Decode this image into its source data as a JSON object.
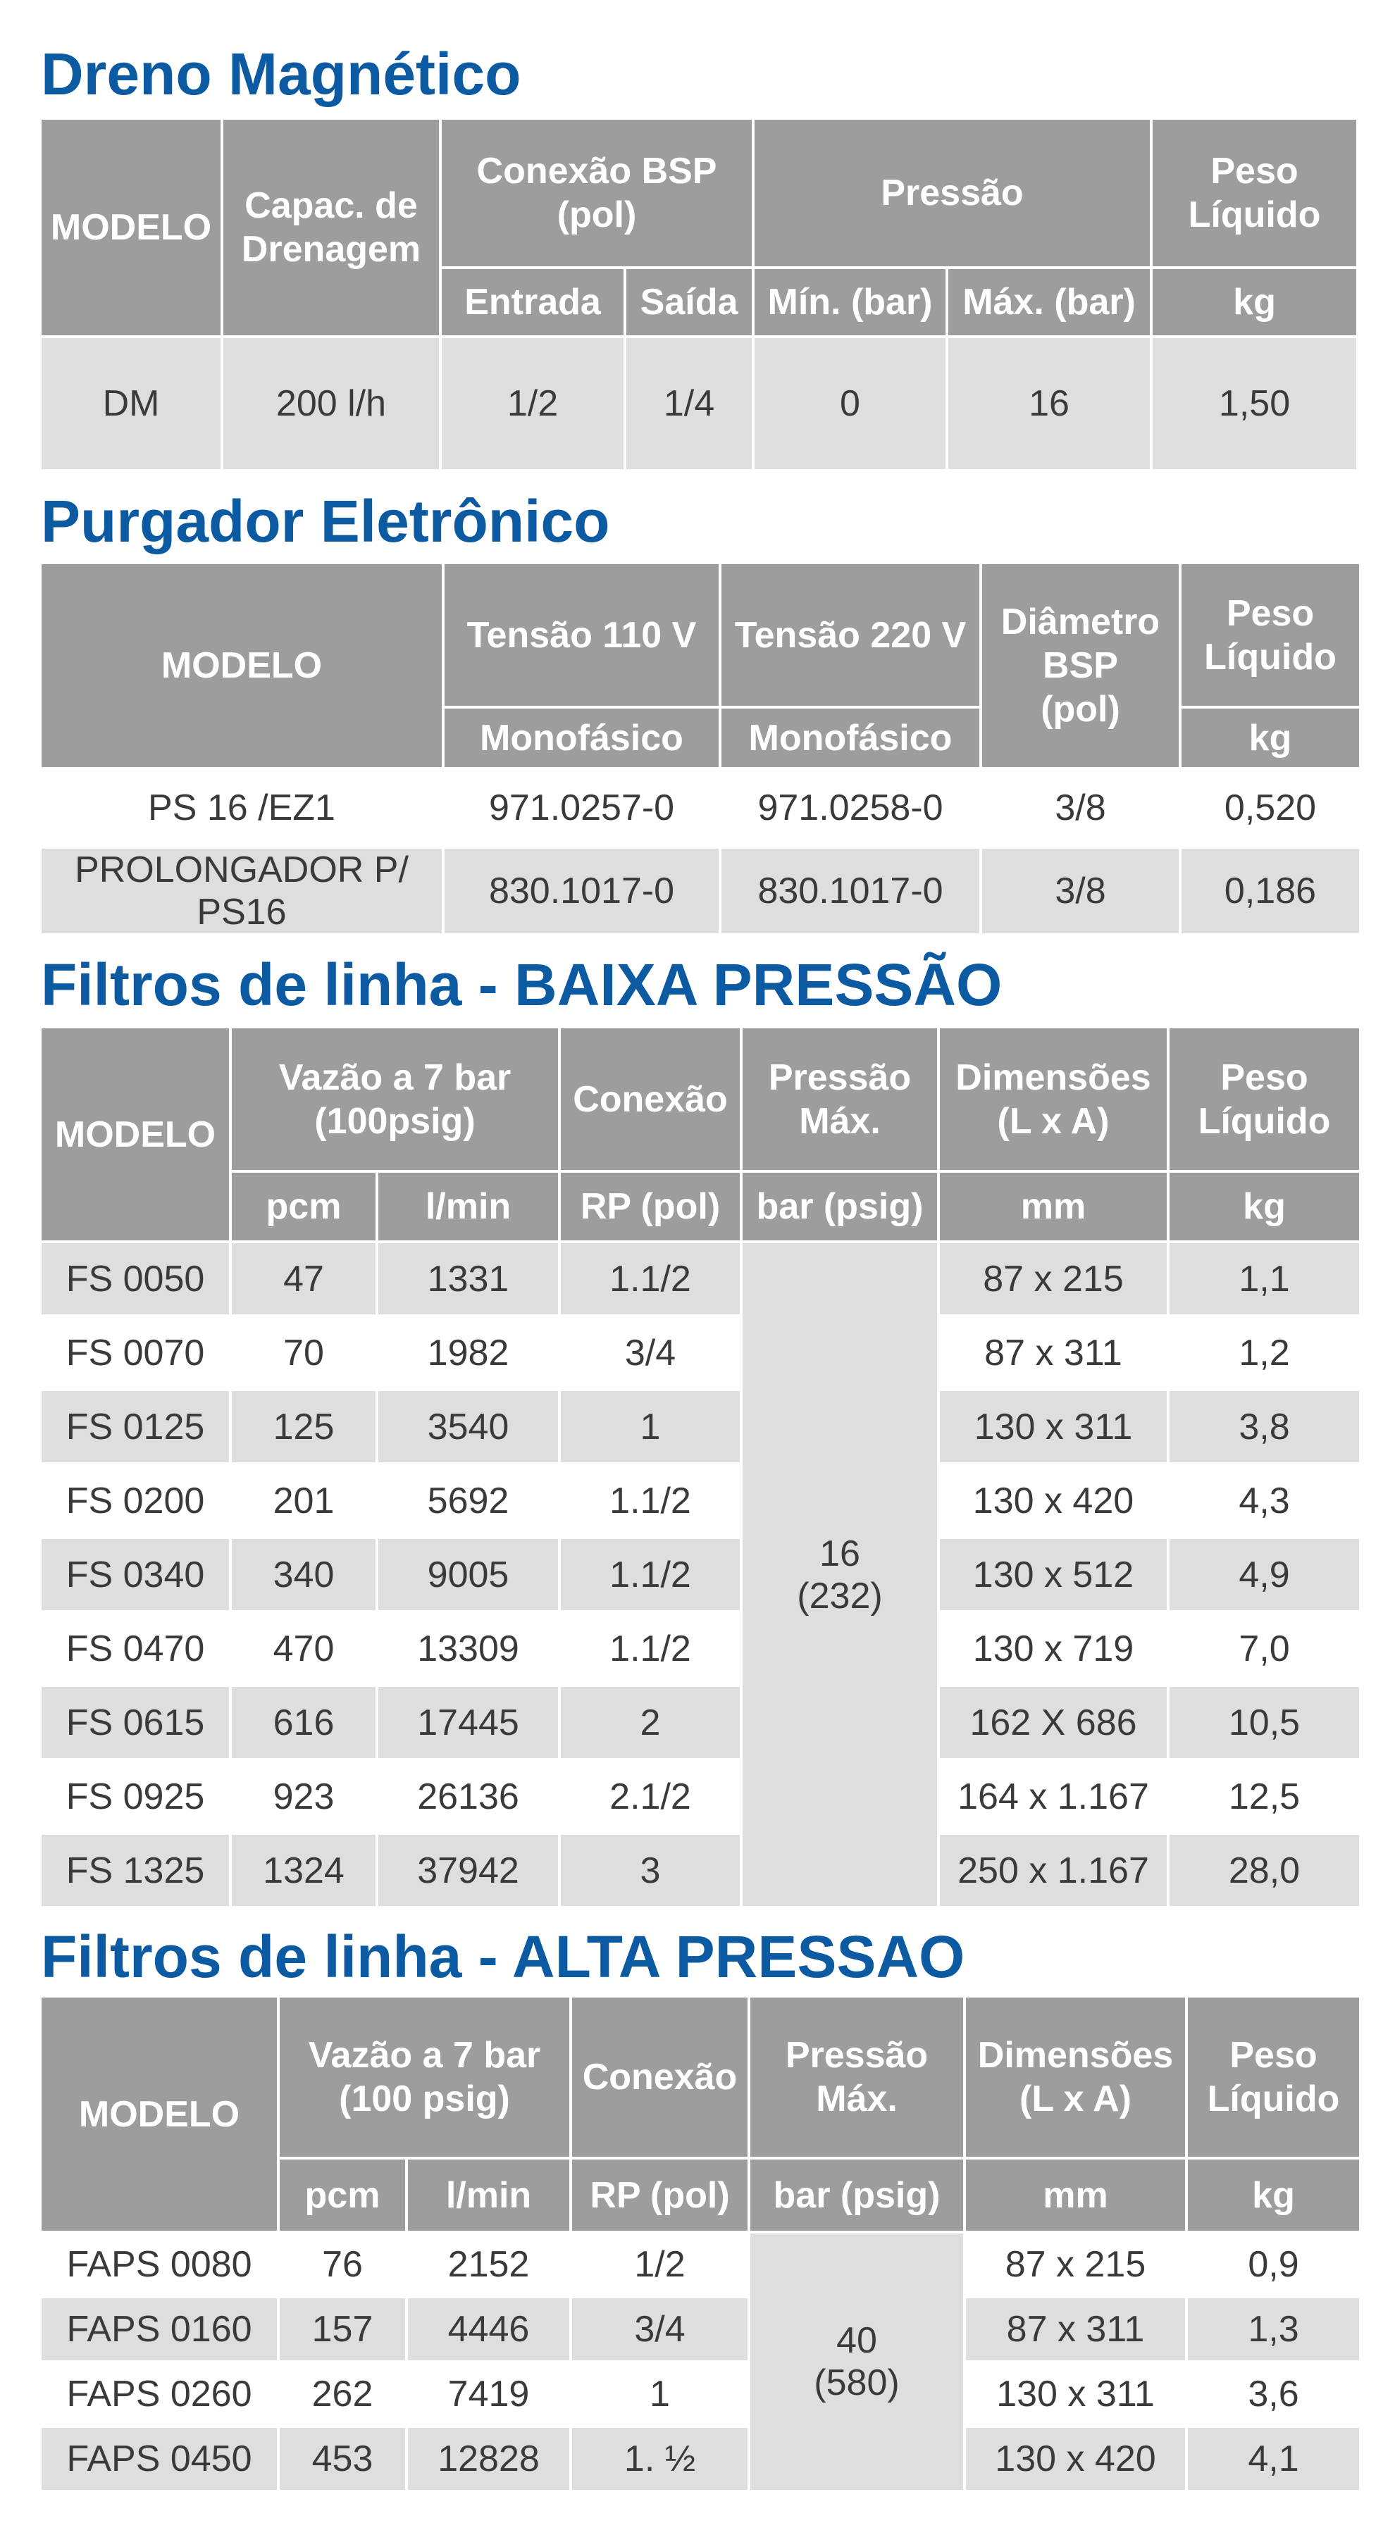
{
  "dreno": {
    "title": "Dreno Magnético",
    "headers": {
      "modelo": "MODELO",
      "capac": "Capac. de\nDrenagem",
      "conexao": "Conexão BSP\n(pol)",
      "pressao": "Pressão",
      "peso": "Peso\nLíquido",
      "entrada": "Entrada",
      "saida": "Saída",
      "min": "Mín. (bar)",
      "max": "Máx. (bar)",
      "kg": "kg"
    },
    "rows": [
      {
        "modelo": "DM",
        "capac": "200 l/h",
        "entrada": "1/2",
        "saida": "1/4",
        "min": "0",
        "max": "16",
        "peso": "1,50"
      }
    ]
  },
  "purgador": {
    "title": "Purgador Eletrônico",
    "headers": {
      "modelo": "MODELO",
      "t110": "Tensão 110 V",
      "t220": "Tensão 220 V",
      "diametro": "Diâmetro\nBSP\n(pol)",
      "peso": "Peso\nLíquido",
      "mono110": "Monofásico",
      "mono220": "Monofásico",
      "kg": "kg"
    },
    "rows": [
      {
        "modelo": "PS 16 /EZ1",
        "t110": "971.0257-0",
        "t220": "971.0258-0",
        "diametro": "3/8",
        "peso": "0,520"
      },
      {
        "modelo": "PROLONGADOR P/ PS16",
        "t110": "830.1017-0",
        "t220": "830.1017-0",
        "diametro": "3/8",
        "peso": "0,186"
      }
    ]
  },
  "baixa": {
    "title": "Filtros de linha - BAIXA PRESSÃO",
    "headers": {
      "modelo": "MODELO",
      "vazao": "Vazão a 7 bar\n(100psig)",
      "conexao": "Conexão",
      "pressao": "Pressão\nMáx.",
      "dimensoes": "Dimensões\n(L x A)",
      "peso": "Peso\nLíquido",
      "pcm": "pcm",
      "lmin": "l/min",
      "rp": "RP (pol)",
      "bar": "bar (psig)",
      "mm": "mm",
      "kg": "kg"
    },
    "pressao_merged": "16\n(232)",
    "rows": [
      {
        "modelo": "FS 0050",
        "pcm": "47",
        "lmin": "1331",
        "rp": "1.1/2",
        "dim": "87 x 215",
        "peso": "1,1"
      },
      {
        "modelo": "FS 0070",
        "pcm": "70",
        "lmin": "1982",
        "rp": "3/4",
        "dim": "87 x 311",
        "peso": "1,2"
      },
      {
        "modelo": "FS 0125",
        "pcm": "125",
        "lmin": "3540",
        "rp": "1",
        "dim": "130 x 311",
        "peso": "3,8"
      },
      {
        "modelo": "FS 0200",
        "pcm": "201",
        "lmin": "5692",
        "rp": "1.1/2",
        "dim": "130 x 420",
        "peso": "4,3"
      },
      {
        "modelo": "FS 0340",
        "pcm": "340",
        "lmin": "9005",
        "rp": "1.1/2",
        "dim": "130 x 512",
        "peso": "4,9"
      },
      {
        "modelo": "FS 0470",
        "pcm": "470",
        "lmin": "13309",
        "rp": "1.1/2",
        "dim": "130 x 719",
        "peso": "7,0"
      },
      {
        "modelo": "FS 0615",
        "pcm": "616",
        "lmin": "17445",
        "rp": "2",
        "dim": "162 X 686",
        "peso": "10,5"
      },
      {
        "modelo": "FS 0925",
        "pcm": "923",
        "lmin": "26136",
        "rp": "2.1/2",
        "dim": "164 x 1.167",
        "peso": "12,5"
      },
      {
        "modelo": "FS 1325",
        "pcm": "1324",
        "lmin": "37942",
        "rp": "3",
        "dim": "250 x 1.167",
        "peso": "28,0"
      }
    ]
  },
  "alta": {
    "title": "Filtros de linha - ALTA PRESSAO",
    "headers": {
      "modelo": "MODELO",
      "vazao": "Vazão a 7 bar\n(100 psig)",
      "conexao": "Conexão",
      "pressao": "Pressão\nMáx.",
      "dimensoes": "Dimensões\n(L x A)",
      "peso": "Peso\nLíquido",
      "pcm": "pcm",
      "lmin": "l/min",
      "rp": "RP (pol)",
      "bar": "bar (psig)",
      "mm": "mm",
      "kg": "kg"
    },
    "pressao_merged": "40\n(580)",
    "rows": [
      {
        "modelo": "FAPS 0080",
        "pcm": "76",
        "lmin": "2152",
        "rp": "1/2",
        "dim": "87 x 215",
        "peso": "0,9"
      },
      {
        "modelo": "FAPS 0160",
        "pcm": "157",
        "lmin": "4446",
        "rp": "3/4",
        "dim": "87 x 311",
        "peso": "1,3"
      },
      {
        "modelo": "FAPS 0260",
        "pcm": "262",
        "lmin": "7419",
        "rp": "1",
        "dim": "130 x 311",
        "peso": "3,6"
      },
      {
        "modelo": "FAPS 0450",
        "pcm": "453",
        "lmin": "12828",
        "rp": "1. ½",
        "dim": "130 x 420",
        "peso": "4,1"
      }
    ]
  }
}
